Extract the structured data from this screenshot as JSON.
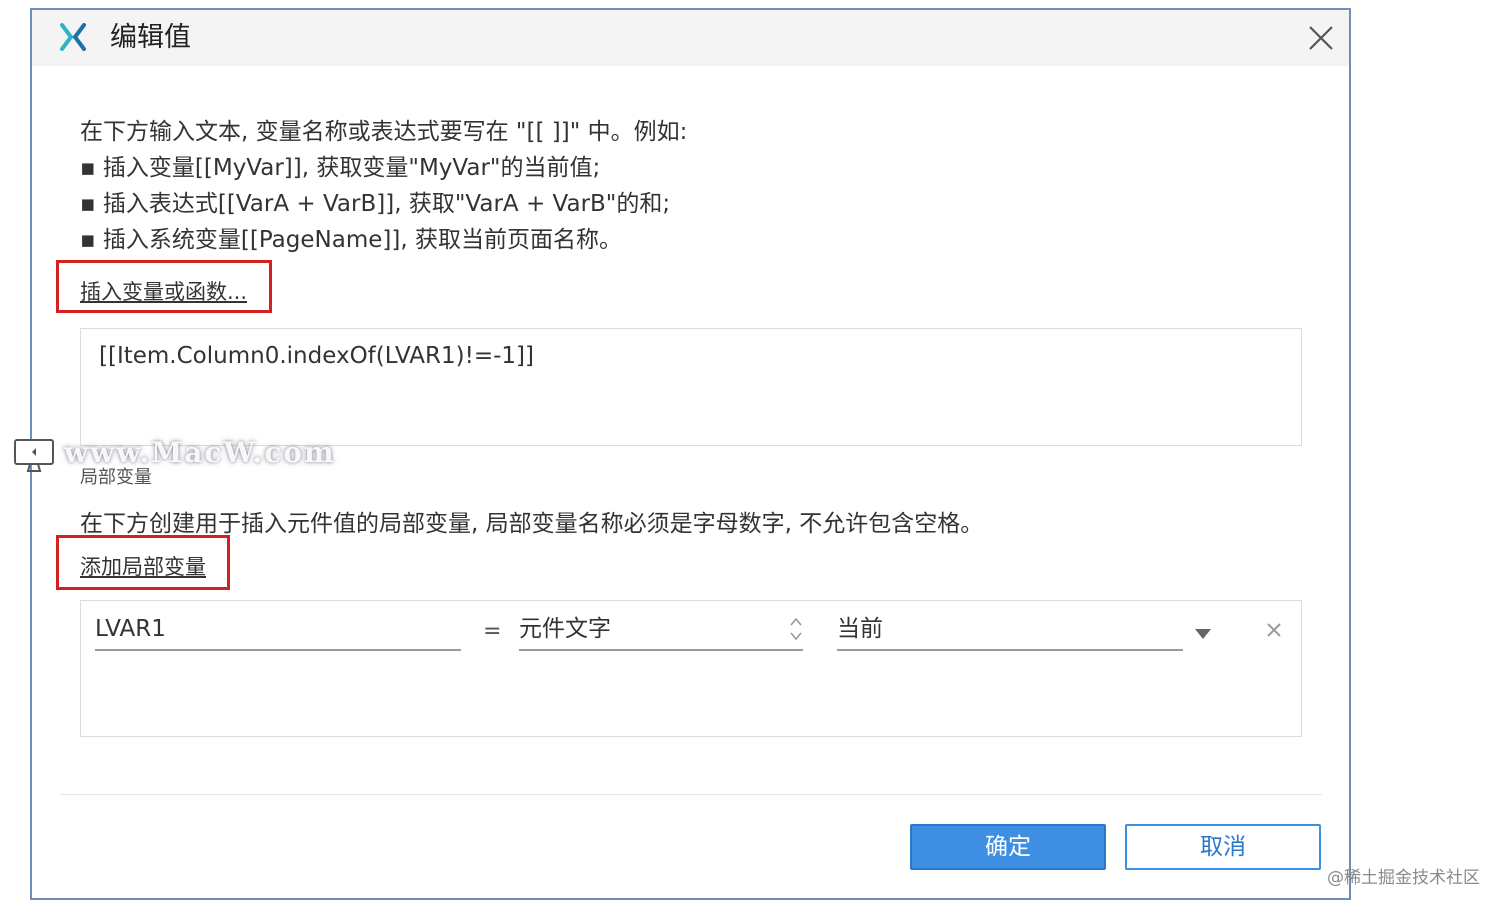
{
  "dialog": {
    "title": "编辑值",
    "app_logo": "axure-x-logo-icon",
    "close_icon": "close-icon"
  },
  "help": {
    "line1": "在下方输入文本, 变量名称或表达式要写在 \"[[ ]]\" 中。例如:",
    "line2": "▪ 插入变量[[MyVar]], 获取变量\"MyVar\"的当前值;",
    "line3": "▪ 插入表达式[[VarA + VarB]], 获取\"VarA + VarB\"的和;",
    "line4": "▪ 插入系统变量[[PageName]], 获取当前页面名称。"
  },
  "insert_link": "插入变量或函数...",
  "expression": "[[Item.Column0.indexOf(LVAR1)!=-1]]",
  "local_vars": {
    "label": "局部变量",
    "description": "在下方创建用于插入元件值的局部变量, 局部变量名称必须是字母数字, 不允许包含空格。",
    "add_link": "添加局部变量",
    "rows": [
      {
        "name": "LVAR1",
        "equals": "=",
        "type": "元件文字",
        "target": "当前"
      }
    ]
  },
  "buttons": {
    "ok": "确定",
    "cancel": "取消"
  },
  "overlay": {
    "watermark": "www.MacW.com",
    "credit": "@稀土掘金技术社区"
  },
  "colors": {
    "accent": "#3e8fe4",
    "highlight": "#d32121",
    "border": "#6f8fb8"
  }
}
